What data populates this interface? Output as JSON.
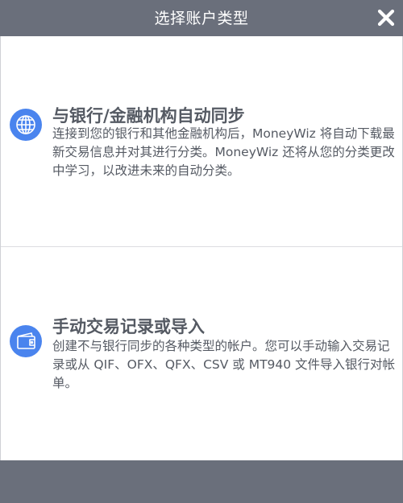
{
  "dialog": {
    "title": "选择账户类型",
    "close_icon": "close-icon"
  },
  "options": [
    {
      "icon": "globe-icon",
      "heading": "与银行/金融机构自动同步",
      "description": "连接到您的银行和其他金融机构后，MoneyWiz 将自动下载最新交易信息并对其进行分类。MoneyWiz 还将从您的分类更改中学习，以改进未来的自动分类。"
    },
    {
      "icon": "wallet-icon",
      "heading": "手动交易记录或导入",
      "description": "创建不与银行同步的各种类型的帐户。您可以手动输入交易记录或从 QIF、OFX、QFX、CSV 或 MT940 文件导入银行对帐单。"
    }
  ],
  "colors": {
    "title_bar": "#6a6f7b",
    "footer_bar": "#6a6f7b",
    "accent": "#4a84ee",
    "text": "#555a63"
  }
}
